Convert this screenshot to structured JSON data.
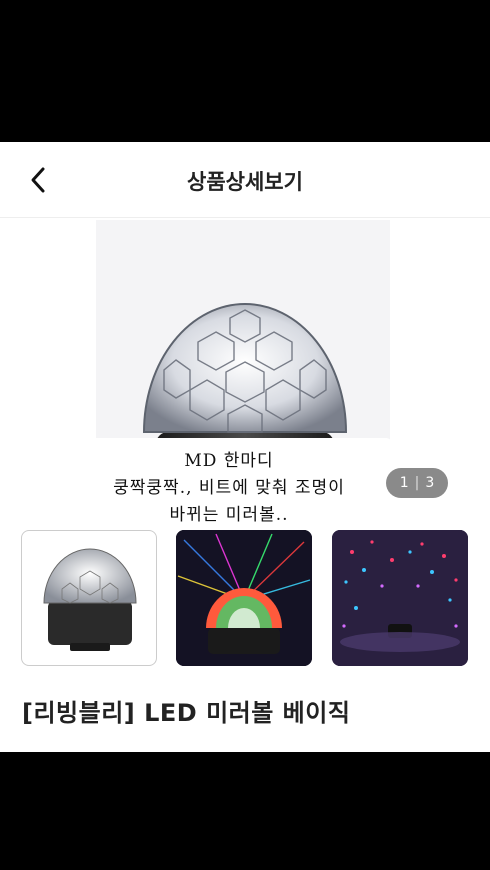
{
  "header": {
    "title": "상품상세보기"
  },
  "gallery": {
    "current": "1",
    "total": "3",
    "separator": "|"
  },
  "md_note": {
    "line1": "MD 한마디",
    "line2": "쿵짝쿵짝., 비트에 맞춰 조명이",
    "line3": "바뀌는 미러볼.."
  },
  "product": {
    "title": "[리빙블리] LED 미러볼 베이직"
  }
}
